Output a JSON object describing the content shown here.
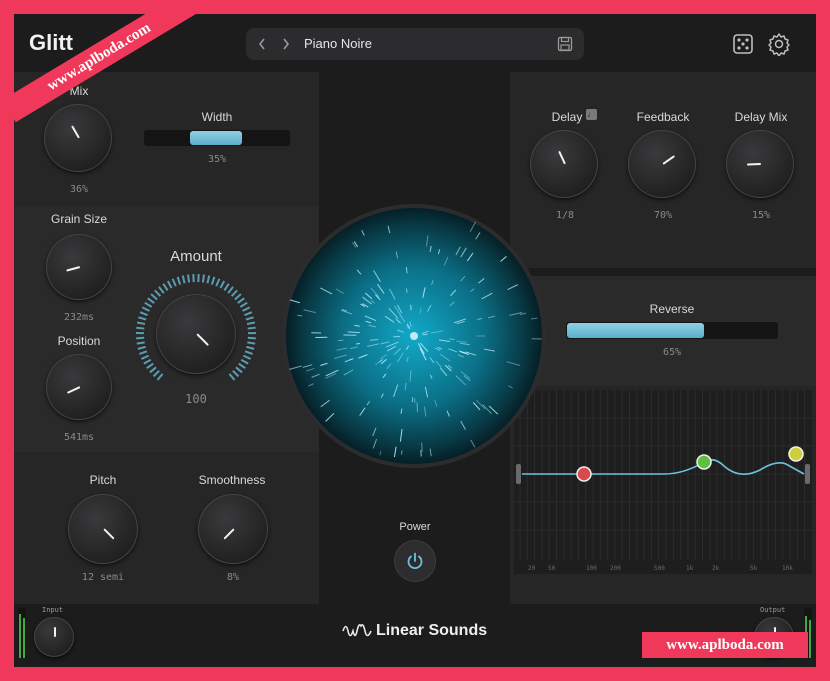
{
  "header": {
    "title": "Glitt",
    "preset_name": "Piano Noire",
    "prev_icon": "chevron-left-icon",
    "next_icon": "chevron-right-icon",
    "save_icon": "save-icon",
    "randomize_icon": "dice-icon",
    "settings_icon": "gear-icon"
  },
  "watermark": {
    "top": "www.aplboda.com",
    "bottom": "www.aplboda.com"
  },
  "grain": {
    "mix": {
      "label": "Mix",
      "value": "36%"
    },
    "width": {
      "label": "Width",
      "value": "35%",
      "level": 0.35
    },
    "grain_size": {
      "label": "Grain Size",
      "value": "232ms"
    },
    "position": {
      "label": "Position",
      "value": "541ms"
    },
    "amount": {
      "label": "Amount",
      "value": "100"
    }
  },
  "delay": {
    "delay": {
      "label": "Delay",
      "value": "1/8",
      "sync_icon": "note-icon"
    },
    "feedback": {
      "label": "Feedback",
      "value": "70%"
    },
    "delay_mix": {
      "label": "Delay Mix",
      "value": "15%"
    }
  },
  "reverse": {
    "label": "Reverse",
    "value": "65%",
    "level": 0.65
  },
  "pitch": {
    "label": "Pitch",
    "value": "12 semi"
  },
  "smoothness": {
    "label": "Smoothness",
    "value": "8%"
  },
  "power": {
    "label": "Power",
    "icon": "power-icon"
  },
  "footer": {
    "brand": "Linear Sounds",
    "brand_icon": "waveform-logo-icon",
    "input_label": "Input",
    "output_label": "Output"
  },
  "eq": {
    "freq_ticks": [
      "20",
      "50",
      "100",
      "200",
      "500",
      "1k",
      "2k",
      "5k",
      "10k"
    ],
    "nodes": [
      {
        "name": "low",
        "color": "#d84b4b"
      },
      {
        "name": "mid",
        "color": "#5fbf3f"
      },
      {
        "name": "high",
        "color": "#cfcf3a"
      }
    ]
  },
  "colors": {
    "accent": "#6cc3de",
    "frame": "#f0385a",
    "background": "#1c1c1d",
    "panel": "#262627"
  }
}
